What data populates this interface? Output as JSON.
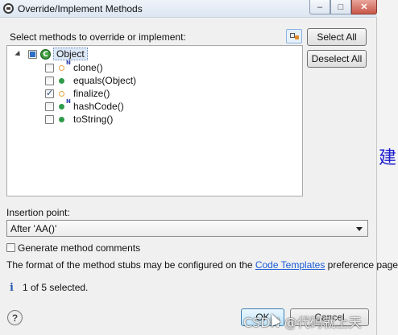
{
  "window": {
    "title": "Override/Implement Methods",
    "minimize_glyph": "–",
    "maximize_glyph": "□",
    "close_glyph": "✕"
  },
  "methods_list": {
    "label": "Select methods to override or implement:",
    "root": {
      "name": "Object",
      "icon": "class-icon",
      "icon_letter": "C",
      "checked": "partial"
    },
    "items": [
      {
        "label": "clone()",
        "checked": false,
        "visibility_icon": "protected-method-icon",
        "badge": "N"
      },
      {
        "label": "equals(Object)",
        "checked": false,
        "visibility_icon": "public-method-icon",
        "badge": ""
      },
      {
        "label": "finalize()",
        "checked": true,
        "visibility_icon": "protected-method-icon",
        "badge": ""
      },
      {
        "label": "hashCode()",
        "checked": false,
        "visibility_icon": "public-method-icon",
        "badge": "N"
      },
      {
        "label": "toString()",
        "checked": false,
        "visibility_icon": "public-method-icon",
        "badge": ""
      }
    ]
  },
  "buttons": {
    "select_all": "Select All",
    "deselect_all": "Deselect All",
    "ok": "OK",
    "cancel": "Cancel",
    "help": "?"
  },
  "insertion_point": {
    "label": "Insertion point:",
    "selected": "After 'AA()'"
  },
  "generate_comments": {
    "label": "Generate method comments",
    "checked": false
  },
  "info": {
    "prefix": "The format of the method stubs may be configured on the ",
    "link": "Code Templates",
    "suffix": " preference page."
  },
  "status": {
    "icon": "info-icon",
    "glyph": "i",
    "text": "1 of 5 selected."
  },
  "watermark": "CSDN @代码就上天",
  "background_glyph": "建.",
  "colors": {
    "link": "#1a5bd6",
    "class_icon": "#2f9a4a",
    "protected_icon": "#e7a33a"
  }
}
